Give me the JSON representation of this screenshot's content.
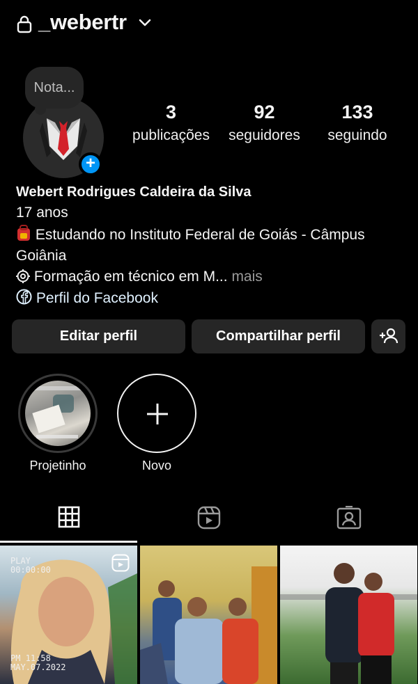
{
  "header": {
    "username": "_webertr"
  },
  "profile": {
    "note": "Nota...",
    "stats": [
      {
        "value": "3",
        "label": "publicações"
      },
      {
        "value": "92",
        "label": "seguidores"
      },
      {
        "value": "133",
        "label": "seguindo"
      }
    ],
    "name": "Webert Rodrigues Caldeira da Silva",
    "age": "17 anos",
    "school": "Estudando no Instituto Federal de Goiás - Câmpus Goiânia",
    "course": "Formação em técnico em M...",
    "more": "mais",
    "facebook": "Perfil do Facebook"
  },
  "actions": {
    "edit": "Editar perfil",
    "share": "Compartilhar perfil"
  },
  "highlights": [
    {
      "label": "Projetinho"
    },
    {
      "label": "Novo"
    }
  ],
  "tabs": [
    "grid-tab",
    "reels-tab",
    "tagged-tab"
  ],
  "posts": {
    "first_overlay": {
      "play": "PLAY",
      "time": "00:00:00",
      "stamp_time": "PM 11:58",
      "stamp_date": "MAY.07.2022"
    }
  },
  "colors": {
    "accent": "#0095f6",
    "button_bg": "#262626",
    "bg": "#000000"
  }
}
